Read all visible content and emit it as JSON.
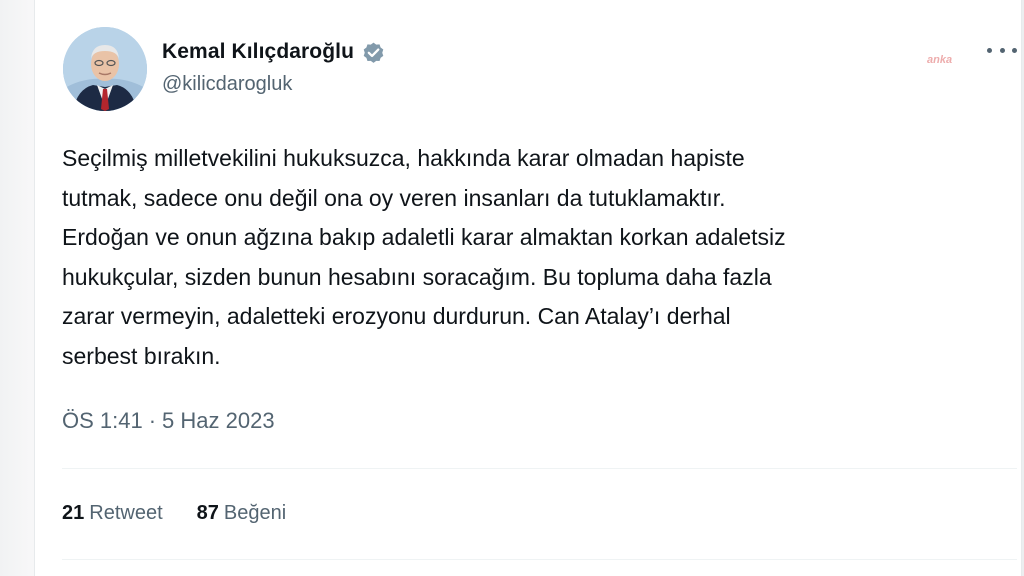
{
  "author": {
    "display_name": "Kemal Kılıçdaroğlu",
    "handle": "@kilicdarogluk",
    "verified": true
  },
  "watermark": "anka",
  "tweet": {
    "lines": [
      "Seçilmiş milletvekilini hukuksuzca, hakkında karar olmadan hapiste",
      "tutmak, sadece onu değil ona oy veren insanları da tutuklamaktır.",
      "Erdoğan ve onun ağzına bakıp adaletli karar almaktan korkan adaletsiz",
      "hukukçular, sizden bunun hesabını soracağım. Bu topluma daha fazla",
      "zarar vermeyin, adaletteki erozyonu durdurun. Can Atalay’ı derhal",
      "serbest bırakın."
    ],
    "time": "ÖS 1:41",
    "separator": "·",
    "date": "5 Haz 2023"
  },
  "stats": {
    "retweet_count": "21",
    "retweet_label": "Retweet",
    "like_count": "87",
    "like_label": "Beğeni"
  },
  "colors": {
    "verified": "#829aab",
    "text_primary": "#0f1419",
    "text_secondary": "#536471",
    "divider": "#eff3f4"
  },
  "icons": {
    "verified": "verified-badge-icon",
    "more": "more-options-icon"
  }
}
